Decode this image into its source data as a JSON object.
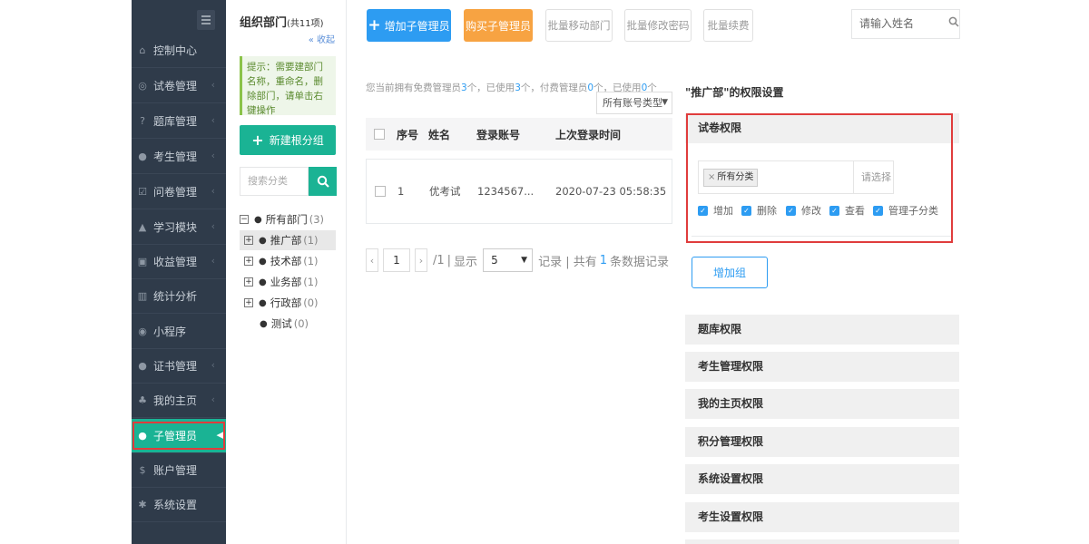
{
  "sidebar": {
    "items": [
      {
        "label": "控制中心",
        "icon": "home-icon"
      },
      {
        "label": "试卷管理",
        "icon": "check-circle-icon"
      },
      {
        "label": "题库管理",
        "icon": "question-circle-icon"
      },
      {
        "label": "考生管理",
        "icon": "user-icon"
      },
      {
        "label": "问卷管理",
        "icon": "checkbox-icon"
      },
      {
        "label": "学习模块",
        "icon": "graduation-cap-icon"
      },
      {
        "label": "收益管理",
        "icon": "money-icon"
      },
      {
        "label": "统计分析",
        "icon": "bar-chart-icon"
      },
      {
        "label": "小程序",
        "icon": "wechat-icon"
      },
      {
        "label": "证书管理",
        "icon": "certificate-icon"
      },
      {
        "label": "我的主页",
        "icon": "leaf-icon"
      },
      {
        "label": "子管理员",
        "icon": "user-admin-icon"
      },
      {
        "label": "账户管理",
        "icon": "dollar-icon"
      },
      {
        "label": "系统设置",
        "icon": "gear-icon"
      }
    ]
  },
  "org": {
    "title": "组织部门",
    "count": "(共11项)",
    "collapse": "收起",
    "tip": "提示：需要建部门名称，重命名，删除部门，请单击右键操作",
    "new_group": "新建根分组",
    "search_placeholder": "搜索分类",
    "tree": [
      {
        "name": "所有部门",
        "count": "(3)",
        "sign": "−"
      },
      {
        "name": "推广部",
        "count": "(1)",
        "sign": "+"
      },
      {
        "name": "技术部",
        "count": "(1)",
        "sign": "+"
      },
      {
        "name": "业务部",
        "count": "(1)",
        "sign": "+"
      },
      {
        "name": "行政部",
        "count": "(0)",
        "sign": "+"
      },
      {
        "name": "测试",
        "count": "(0)",
        "sign": ""
      }
    ]
  },
  "toolbar": {
    "add_sub_admin": "增加子管理员",
    "buy_sub_admin": "购买子管理员",
    "batch_move": "批量移动部门",
    "batch_password": "批量修改密码",
    "batch_renew": "批量续费",
    "name_placeholder": "请输入姓名"
  },
  "list": {
    "info": {
      "p1": "您当前拥有免费管理员",
      "free": "3",
      "p2": "个，已使用",
      "used": "3",
      "p3": "个，付费管理员",
      "paid": "0",
      "p4": "个，已使用",
      "paid_used": "0",
      "p5": "个"
    },
    "account_type": "所有账号类型",
    "headers": {
      "seq": "序号",
      "name": "姓名",
      "account": "登录账号",
      "last_login": "上次登录时间"
    },
    "rows": [
      {
        "seq": "1",
        "name": "优考试",
        "account": "1234567...",
        "last_login": "2020-07-23 05:58:35"
      }
    ],
    "pager": {
      "page": "1",
      "total_pages": "/1",
      "show": "显示",
      "per_page": "5",
      "records": "记录 | 共有",
      "total": "1",
      "records_suffix": "条数据记录"
    }
  },
  "permissions": {
    "title": "\"推广部\"的权限设置",
    "exam_perm": "试卷权限",
    "tag": "所有分类",
    "please_select": "请选择",
    "checkboxes": [
      "增加",
      "删除",
      "修改",
      "查看",
      "管理子分类"
    ],
    "add_group": "增加组",
    "sections": [
      "题库权限",
      "考生管理权限",
      "我的主页权限",
      "积分管理权限",
      "系统设置权限",
      "考生设置权限"
    ]
  },
  "colors": {
    "sidebar_bg": "#2f3b4a",
    "accent_green": "#1ab394",
    "accent_blue": "#2d9cf2",
    "accent_orange": "#f7a342",
    "highlight_red": "#e03c3c"
  }
}
